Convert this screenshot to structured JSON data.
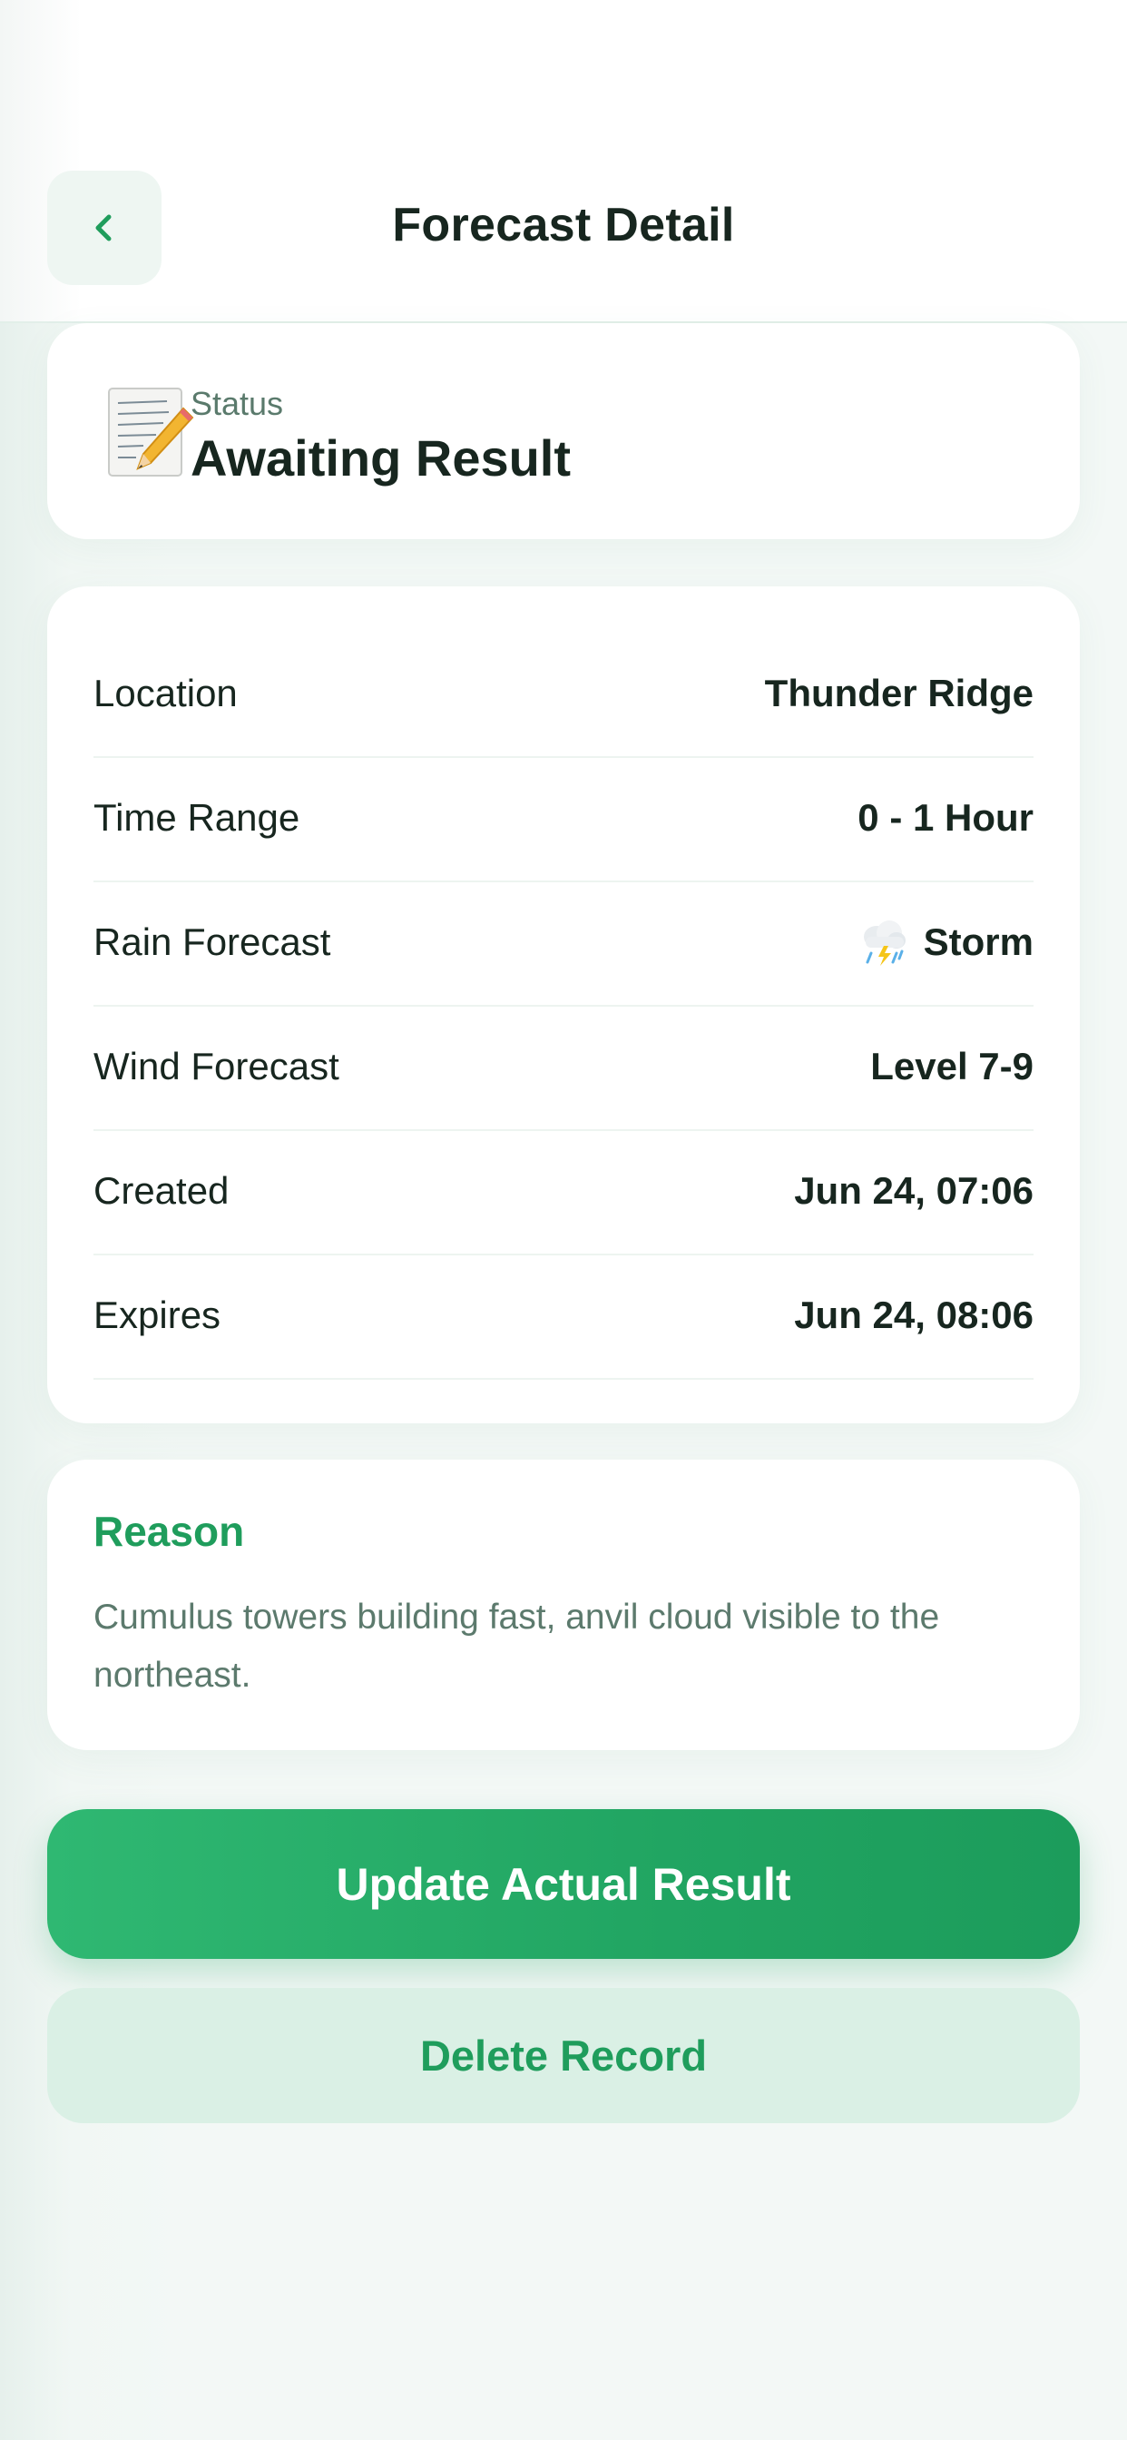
{
  "header": {
    "title": "Forecast Detail",
    "back_icon": "chevron-left-icon"
  },
  "status": {
    "icon": "memo-pencil-icon",
    "label": "Status",
    "value": "Awaiting Result"
  },
  "details": {
    "rows": [
      {
        "label": "Location",
        "value": "Thunder Ridge"
      },
      {
        "label": "Time Range",
        "value": "0 - 1 Hour"
      },
      {
        "label": "Rain Forecast",
        "value": "Storm",
        "icon": "thunder-cloud-rain-icon"
      },
      {
        "label": "Wind Forecast",
        "value": "Level 7-9"
      },
      {
        "label": "Created",
        "value": "Jun 24, 07:06"
      },
      {
        "label": "Expires",
        "value": "Jun 24, 08:06"
      }
    ]
  },
  "reason": {
    "title": "Reason",
    "text": "Cumulus towers building fast, anvil cloud visible to the northeast."
  },
  "actions": {
    "primary_label": "Update Actual Result",
    "secondary_label": "Delete Record"
  },
  "colors": {
    "accent": "#21a562",
    "accent_text": "#1f9d5c",
    "secondary_bg": "#daf0e5",
    "text_primary": "#17261f",
    "text_secondary": "#5c7a6d"
  }
}
